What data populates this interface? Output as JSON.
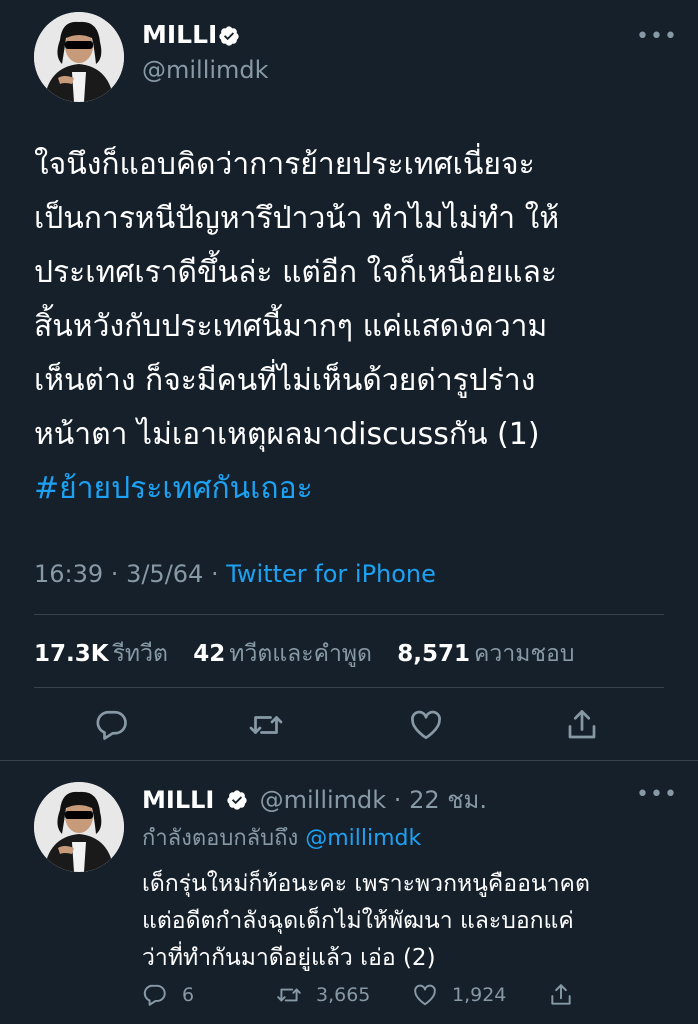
{
  "main_tweet": {
    "author_name": "MILLI",
    "handle": "@millimdk",
    "more_label": "•••",
    "text_lines": [
      "ใจนึงก็แอบคิดว่าการย้ายประเทศเนี่ยจะ",
      "เป็นการหนีปัญหารึป่าวน้า ทำไมไม่ทำ ให้",
      "ประเทศเราดีขึ้นล่ะ แต่อีก ใจก็เหนื่อยและ",
      "สิ้นหวังกับประเทศนี้มากๆ แค่แสดงความ",
      "เห็นต่าง ก็จะมีคนที่ไม่เห็นด้วยด่ารูปร่าง",
      "หน้าตา ไม่เอาเหตุผลมาdiscussกัน (1)"
    ],
    "hashtag": "#ย้ายประเทศกันเถอะ",
    "time": "16:39",
    "date": "3/5/64",
    "separator": " · ",
    "source": "Twitter for iPhone",
    "stats": {
      "retweets": "17.3K",
      "retweets_label": "รีทวีต",
      "quotes": "42",
      "quotes_label": "ทวีตและคำพูด",
      "likes": "8,571",
      "likes_label": "ความชอบ"
    }
  },
  "reply_tweet": {
    "author_name": "MILLI",
    "handle": "@millimdk",
    "time_ago": "22 ชม.",
    "separator": " · ",
    "more_label": "•••",
    "replying_to_prefix": "กำลังตอบกลับถึง",
    "replying_to_handle": "@millimdk",
    "text_lines": [
      "เด็กรุ่นใหม่ก็ท้อนะคะ เพราะพวกหนูคืออนาคต",
      "แต่อดีตกำลังฉุดเด็กไม่ให้พัฒนา และบอกแค่",
      "ว่าที่ทำกันมาดีอยู่แล้ว เอ่อ (2)"
    ],
    "reply_count": "6",
    "retweet_count": "3,665",
    "like_count": "1,924"
  },
  "icons": {
    "verified": "verified-badge-icon",
    "reply": "reply-icon",
    "retweet": "retweet-icon",
    "like": "like-icon",
    "share": "share-icon"
  },
  "colors": {
    "background": "#15202b",
    "accent": "#1da1f2",
    "secondary_text": "#8899a6",
    "divider": "#38444d"
  }
}
